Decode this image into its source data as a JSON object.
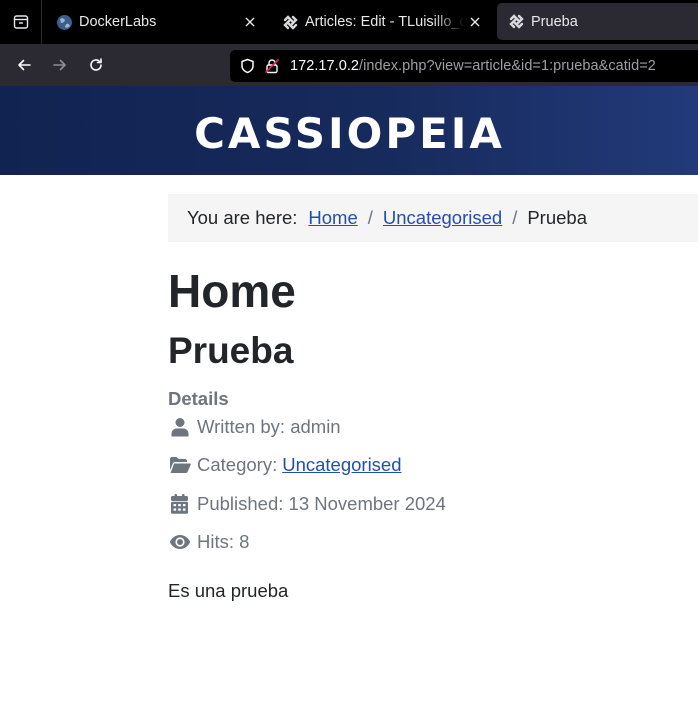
{
  "browser": {
    "tabs": [
      {
        "title": "DockerLabs",
        "favicon": "globe-icon",
        "active": false
      },
      {
        "title": "Articles: Edit - TLuisillo_o",
        "favicon": "joomla-icon",
        "active": false
      },
      {
        "title": "Prueba",
        "favicon": "joomla-icon",
        "active": true
      }
    ],
    "url_host": "172.17.0.2",
    "url_path": "/index.php?view=article&id=1:prueba&catid=2"
  },
  "site": {
    "brand": "CASSIOPEIA",
    "header_gradient": [
      "#112351",
      "#223a7a"
    ]
  },
  "breadcrumb": {
    "prefix": "You are here:",
    "items": [
      "Home",
      "Uncategorised",
      "Prueba"
    ],
    "separator": "/"
  },
  "article": {
    "page_heading": "Home",
    "title": "Prueba",
    "details_label": "Details",
    "author_label": "Written by: admin",
    "category_label": "Category: ",
    "category_value": "Uncategorised",
    "published_label": "Published: 13 November 2024",
    "hits_label": "Hits: 8",
    "body": "Es una prueba"
  },
  "colors": {
    "link": "#224faa",
    "text": "#22262a",
    "muted": "#6d757e"
  }
}
